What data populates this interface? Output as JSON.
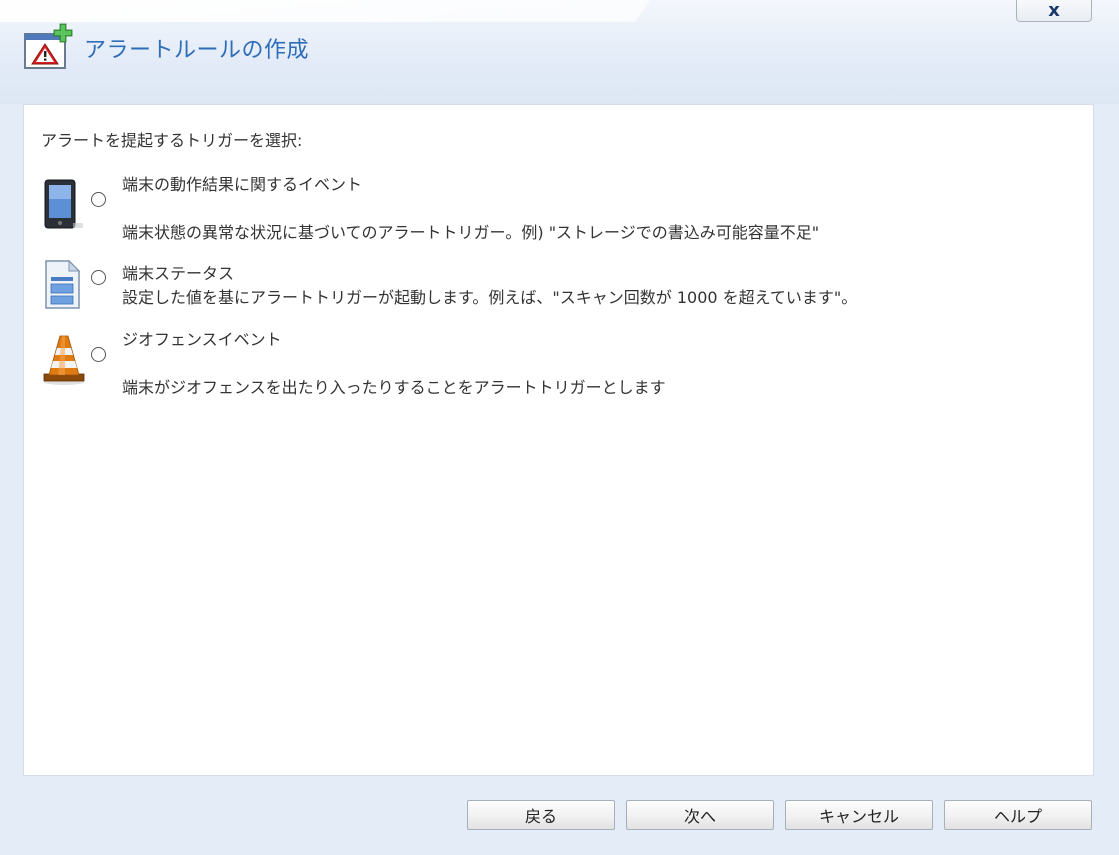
{
  "window": {
    "title": "アラートルールの作成",
    "close_label": "x"
  },
  "content": {
    "prompt": "アラートを提起するトリガーを選択:",
    "options": [
      {
        "title": "端末の動作結果に関するイベント",
        "description": "端末状態の異常な状況に基づいてのアラートトリガー。例) \"ストレージでの書込み可能容量不足\"",
        "icon": "mobile-device-icon",
        "selected": false
      },
      {
        "title": "端末ステータス",
        "description": "設定した値を基にアラートトリガーが起動します。例えば、\"スキャン回数が 1000 を超えています\"。",
        "icon": "document-status-icon",
        "selected": false
      },
      {
        "title": "ジオフェンスイベント",
        "description": "端末がジオフェンスを出たり入ったりすることをアラートトリガーとします",
        "icon": "traffic-cone-icon",
        "selected": false
      }
    ]
  },
  "footer": {
    "back_label": "戻る",
    "next_label": "次へ",
    "cancel_label": "キャンセル",
    "help_label": "ヘルプ"
  },
  "colors": {
    "title_blue": "#2f6db8",
    "header_bg": "#e2ebf7",
    "panel_bg": "#ffffff"
  }
}
